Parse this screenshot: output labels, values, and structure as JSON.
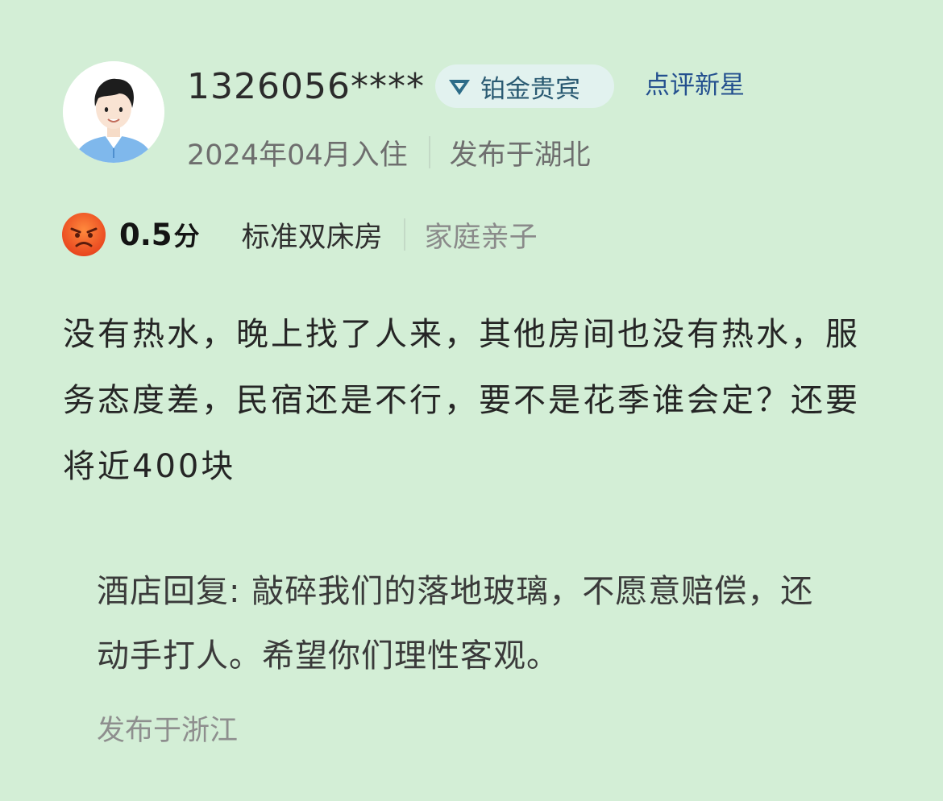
{
  "reviewer": {
    "username": "1326056****",
    "membership_badge": "铂金贵宾",
    "membership_icon": "diamond-icon",
    "title_label": "点评新星",
    "stay_date": "2024年04月入住",
    "posted_from": "发布于湖北"
  },
  "rating": {
    "icon": "angry-face-icon",
    "score": "0.5",
    "unit": "分",
    "room_type": "标准双床房",
    "trip_type": "家庭亲子"
  },
  "review": {
    "text": "没有热水，晚上找了人来，其他房间也没有热水，服务态度差，民宿还是不行，要不是花季谁会定？还要将近400块"
  },
  "hotel_reply": {
    "text": "酒店回复: 敲碎我们的落地玻璃，不愿意赔偿，还动手打人。希望你们理性客观。",
    "posted_from": "发布于浙江"
  },
  "colors": {
    "background": "#d3eed6",
    "badge_background": "#e2f2ef",
    "badge_text": "#2a5a72",
    "title_label": "#24508f"
  }
}
